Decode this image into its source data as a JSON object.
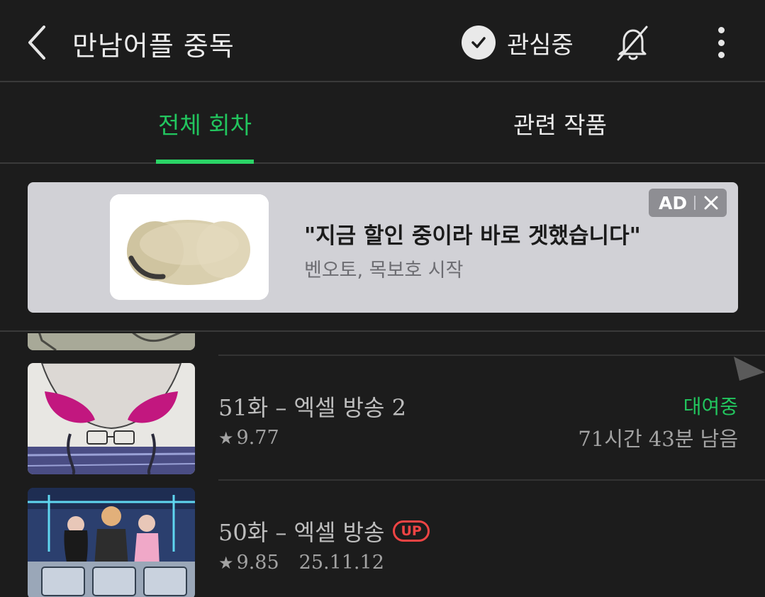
{
  "header": {
    "title": "만남어플 중독",
    "follow_label": "관심중"
  },
  "tabs": [
    {
      "label": "전체 회차",
      "active": true
    },
    {
      "label": "관련 작품",
      "active": false
    }
  ],
  "ad": {
    "headline": "\"지금 할인 중이라 바로 겟했습니다\"",
    "subtext": "벤오토, 목보호 시작",
    "badge": "AD"
  },
  "episodes": [
    {
      "title": "51화 – 엑셀 방송 2",
      "rating": "9.77",
      "status": "대여중",
      "remaining": "71시간 43분 남음"
    },
    {
      "title": "50화 – 엑셀 방송",
      "badge": "UP",
      "rating": "9.85",
      "date": "25.11.12"
    }
  ],
  "colors": {
    "accent": "#2bd466",
    "background": "#1c1c1c",
    "up_badge": "#ef4444",
    "ad_background": "#d1d1d6"
  },
  "icons": {
    "back": "chevron-left-icon",
    "follow": "check-circle-icon",
    "notifications": "bell-off-icon",
    "more": "more-vertical-icon",
    "ad_close": "close-icon",
    "rating": "star-icon"
  }
}
